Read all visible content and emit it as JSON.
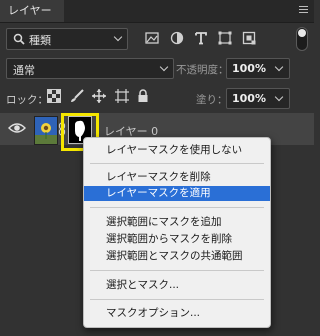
{
  "panel": {
    "tab_label": "レイヤー"
  },
  "filter": {
    "kind_label": "種類"
  },
  "blend": {
    "mode": "通常",
    "opacity_label": "不透明度：",
    "opacity_value": "100%"
  },
  "lock": {
    "label": "ロック：",
    "fill_label": "塗り：",
    "fill_value": "100%"
  },
  "layer": {
    "name": "レイヤー 0"
  },
  "context_menu": {
    "groups": [
      [
        "レイヤーマスクを使用しない"
      ],
      [
        "レイヤーマスクを削除",
        "レイヤーマスクを適用"
      ],
      [
        "選択範囲にマスクを追加",
        "選択範囲からマスクを削除",
        "選択範囲とマスクの共通範囲"
      ],
      [
        "選択とマスク..."
      ],
      [
        "マスクオプション..."
      ]
    ],
    "selected_item": "レイヤーマスクを適用"
  },
  "colors": {
    "highlight_border": "#f5e600",
    "menu_selection": "#2a6fd6"
  }
}
